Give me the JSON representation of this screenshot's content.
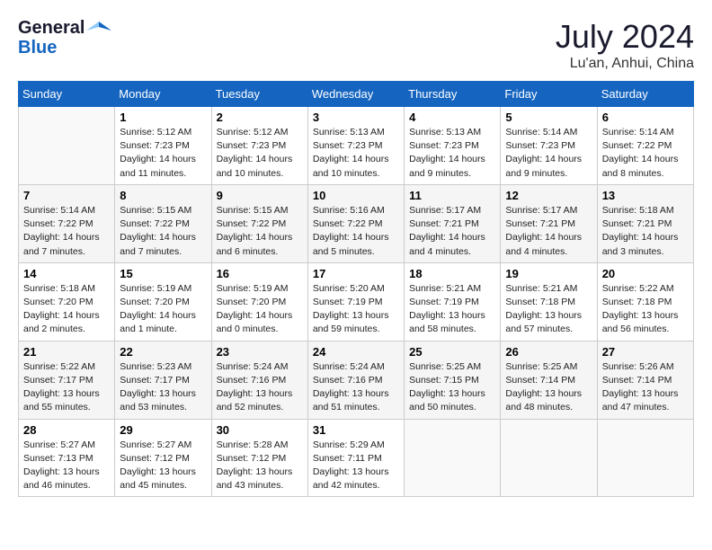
{
  "header": {
    "logo_line1": "General",
    "logo_line2": "Blue",
    "month_title": "July 2024",
    "location": "Lu'an, Anhui, China"
  },
  "days_of_week": [
    "Sunday",
    "Monday",
    "Tuesday",
    "Wednesday",
    "Thursday",
    "Friday",
    "Saturday"
  ],
  "weeks": [
    [
      {
        "day": "",
        "info": ""
      },
      {
        "day": "1",
        "info": "Sunrise: 5:12 AM\nSunset: 7:23 PM\nDaylight: 14 hours\nand 11 minutes."
      },
      {
        "day": "2",
        "info": "Sunrise: 5:12 AM\nSunset: 7:23 PM\nDaylight: 14 hours\nand 10 minutes."
      },
      {
        "day": "3",
        "info": "Sunrise: 5:13 AM\nSunset: 7:23 PM\nDaylight: 14 hours\nand 10 minutes."
      },
      {
        "day": "4",
        "info": "Sunrise: 5:13 AM\nSunset: 7:23 PM\nDaylight: 14 hours\nand 9 minutes."
      },
      {
        "day": "5",
        "info": "Sunrise: 5:14 AM\nSunset: 7:23 PM\nDaylight: 14 hours\nand 9 minutes."
      },
      {
        "day": "6",
        "info": "Sunrise: 5:14 AM\nSunset: 7:22 PM\nDaylight: 14 hours\nand 8 minutes."
      }
    ],
    [
      {
        "day": "7",
        "info": "Sunrise: 5:14 AM\nSunset: 7:22 PM\nDaylight: 14 hours\nand 7 minutes."
      },
      {
        "day": "8",
        "info": "Sunrise: 5:15 AM\nSunset: 7:22 PM\nDaylight: 14 hours\nand 7 minutes."
      },
      {
        "day": "9",
        "info": "Sunrise: 5:15 AM\nSunset: 7:22 PM\nDaylight: 14 hours\nand 6 minutes."
      },
      {
        "day": "10",
        "info": "Sunrise: 5:16 AM\nSunset: 7:22 PM\nDaylight: 14 hours\nand 5 minutes."
      },
      {
        "day": "11",
        "info": "Sunrise: 5:17 AM\nSunset: 7:21 PM\nDaylight: 14 hours\nand 4 minutes."
      },
      {
        "day": "12",
        "info": "Sunrise: 5:17 AM\nSunset: 7:21 PM\nDaylight: 14 hours\nand 4 minutes."
      },
      {
        "day": "13",
        "info": "Sunrise: 5:18 AM\nSunset: 7:21 PM\nDaylight: 14 hours\nand 3 minutes."
      }
    ],
    [
      {
        "day": "14",
        "info": "Sunrise: 5:18 AM\nSunset: 7:20 PM\nDaylight: 14 hours\nand 2 minutes."
      },
      {
        "day": "15",
        "info": "Sunrise: 5:19 AM\nSunset: 7:20 PM\nDaylight: 14 hours\nand 1 minute."
      },
      {
        "day": "16",
        "info": "Sunrise: 5:19 AM\nSunset: 7:20 PM\nDaylight: 14 hours\nand 0 minutes."
      },
      {
        "day": "17",
        "info": "Sunrise: 5:20 AM\nSunset: 7:19 PM\nDaylight: 13 hours\nand 59 minutes."
      },
      {
        "day": "18",
        "info": "Sunrise: 5:21 AM\nSunset: 7:19 PM\nDaylight: 13 hours\nand 58 minutes."
      },
      {
        "day": "19",
        "info": "Sunrise: 5:21 AM\nSunset: 7:18 PM\nDaylight: 13 hours\nand 57 minutes."
      },
      {
        "day": "20",
        "info": "Sunrise: 5:22 AM\nSunset: 7:18 PM\nDaylight: 13 hours\nand 56 minutes."
      }
    ],
    [
      {
        "day": "21",
        "info": "Sunrise: 5:22 AM\nSunset: 7:17 PM\nDaylight: 13 hours\nand 55 minutes."
      },
      {
        "day": "22",
        "info": "Sunrise: 5:23 AM\nSunset: 7:17 PM\nDaylight: 13 hours\nand 53 minutes."
      },
      {
        "day": "23",
        "info": "Sunrise: 5:24 AM\nSunset: 7:16 PM\nDaylight: 13 hours\nand 52 minutes."
      },
      {
        "day": "24",
        "info": "Sunrise: 5:24 AM\nSunset: 7:16 PM\nDaylight: 13 hours\nand 51 minutes."
      },
      {
        "day": "25",
        "info": "Sunrise: 5:25 AM\nSunset: 7:15 PM\nDaylight: 13 hours\nand 50 minutes."
      },
      {
        "day": "26",
        "info": "Sunrise: 5:25 AM\nSunset: 7:14 PM\nDaylight: 13 hours\nand 48 minutes."
      },
      {
        "day": "27",
        "info": "Sunrise: 5:26 AM\nSunset: 7:14 PM\nDaylight: 13 hours\nand 47 minutes."
      }
    ],
    [
      {
        "day": "28",
        "info": "Sunrise: 5:27 AM\nSunset: 7:13 PM\nDaylight: 13 hours\nand 46 minutes."
      },
      {
        "day": "29",
        "info": "Sunrise: 5:27 AM\nSunset: 7:12 PM\nDaylight: 13 hours\nand 45 minutes."
      },
      {
        "day": "30",
        "info": "Sunrise: 5:28 AM\nSunset: 7:12 PM\nDaylight: 13 hours\nand 43 minutes."
      },
      {
        "day": "31",
        "info": "Sunrise: 5:29 AM\nSunset: 7:11 PM\nDaylight: 13 hours\nand 42 minutes."
      },
      {
        "day": "",
        "info": ""
      },
      {
        "day": "",
        "info": ""
      },
      {
        "day": "",
        "info": ""
      }
    ]
  ]
}
